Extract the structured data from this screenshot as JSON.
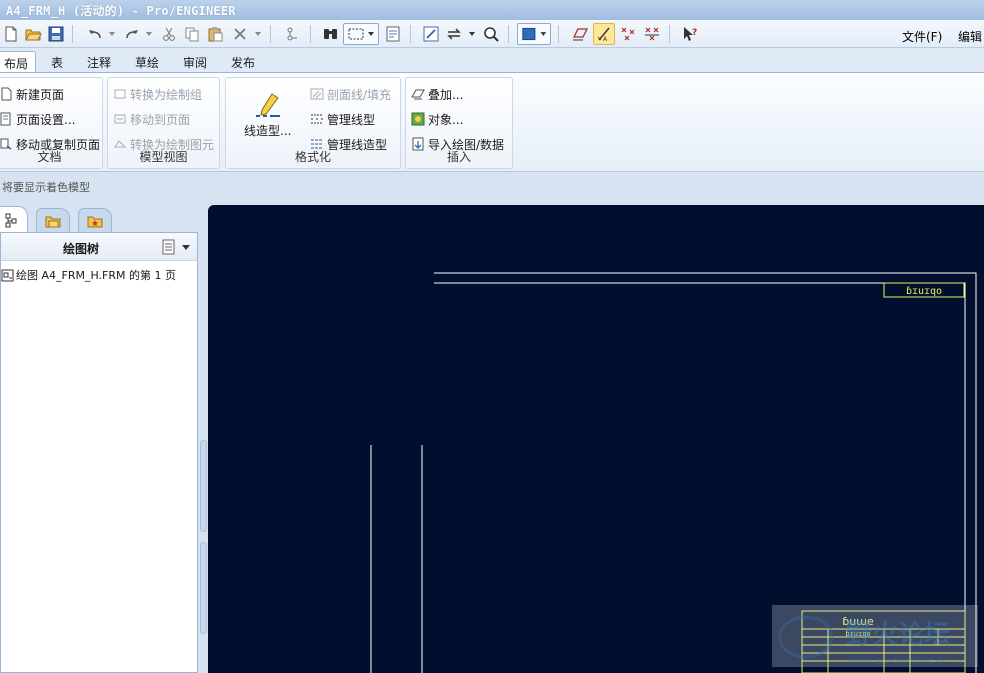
{
  "window": {
    "title": "A4_FRM_H (活动的) - Pro/ENGINEER"
  },
  "quick_toolbar": {
    "menu_file": "文件(F)",
    "menu_edit": "编辑"
  },
  "tabs": [
    {
      "label": "布局",
      "active": true
    },
    {
      "label": "表",
      "active": false
    },
    {
      "label": "注释",
      "active": false
    },
    {
      "label": "草绘",
      "active": false
    },
    {
      "label": "审阅",
      "active": false
    },
    {
      "label": "发布",
      "active": false
    }
  ],
  "ribbon": {
    "document": {
      "label": "文档",
      "new_page": "新建页面",
      "page_setup": "页面设置...",
      "move_copy_page": "移动或复制页面"
    },
    "model_view": {
      "label": "模型视图",
      "to_drawing_group": "转换为绘制组",
      "move_to_page": "移动到页面",
      "to_drawing_item": "转换为绘制图元"
    },
    "format": {
      "label": "格式化",
      "line_style": "线造型...",
      "hatch": "剖面线/填充",
      "manage_linetype": "管理线型",
      "manage_linestyle": "管理线造型"
    },
    "insert": {
      "label": "插入",
      "overlay": "叠加...",
      "object": "对象...",
      "import_drawing": "导入绘图/数据"
    }
  },
  "message_line": "将要显示着色模型",
  "model_tree": {
    "header": "绘图树",
    "item": "绘图 A4_FRM_H.FRM 的第 1 页"
  },
  "drawing": {
    "corner_label": "ɓɪuɪqo",
    "title_block_name": "ɓuɯe",
    "title_block_sub": "ɓɪuɪqo",
    "line_color": "#ffffff",
    "title_block_color": "#e8f060",
    "background": "#000f2e"
  },
  "watermark": {
    "text": "野火论坛",
    "url": "www.proewildfire.cn"
  }
}
